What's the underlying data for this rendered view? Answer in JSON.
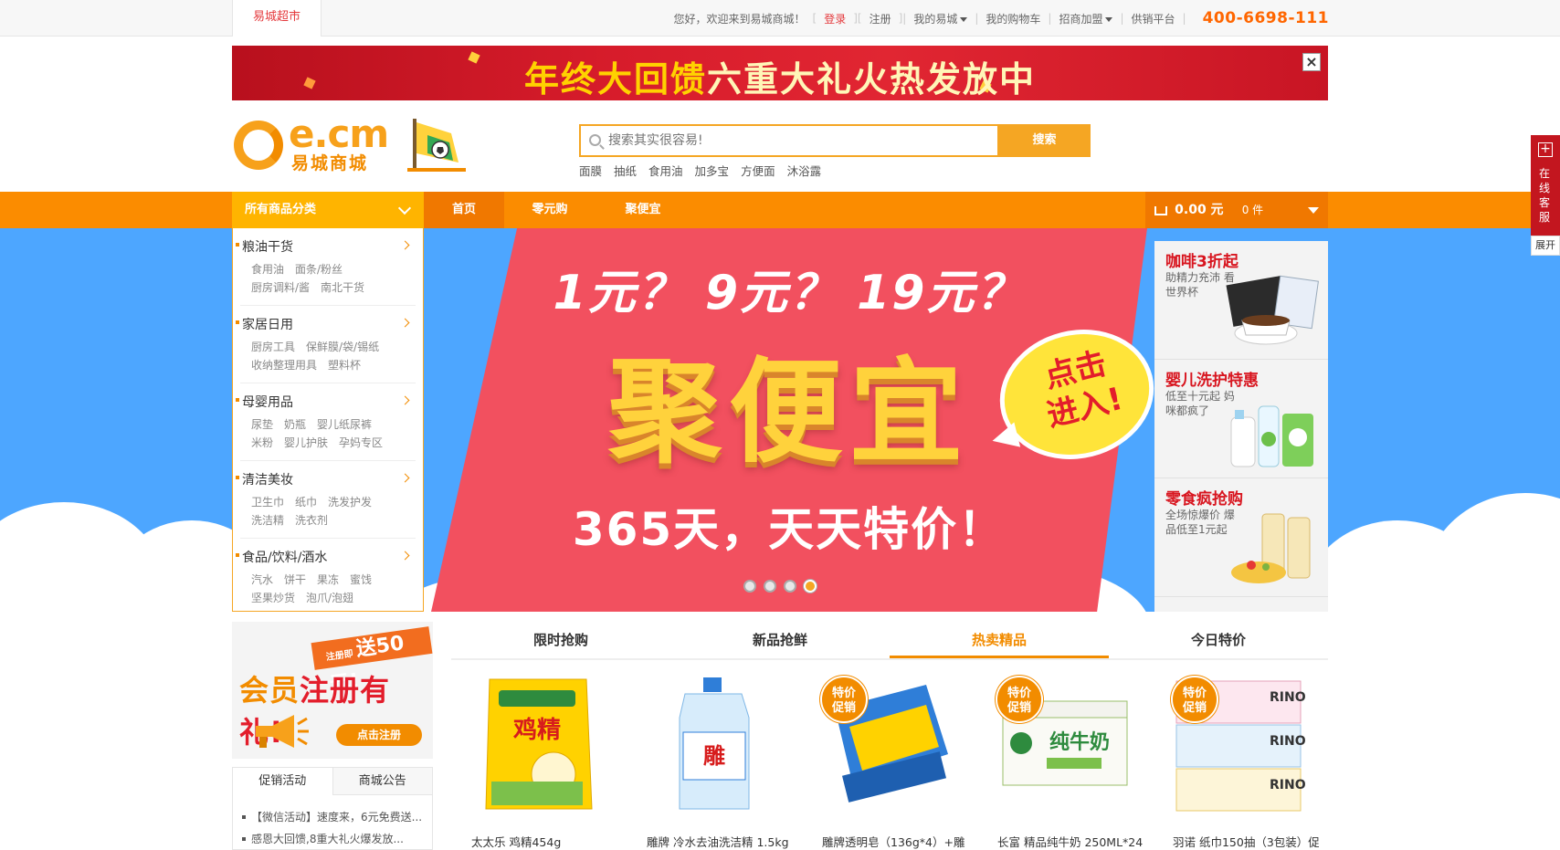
{
  "topbar": {
    "site_tab": "易城超市",
    "welcome": "您好，欢迎来到易城商城！",
    "login": "登录",
    "register": "注册",
    "my_account": "我的易城",
    "my_cart": "我的购物车",
    "join": "招商加盟",
    "supply": "供销平台",
    "hotline": "400-6698-111"
  },
  "promo_banner": {
    "text_a": "年终大回馈",
    "text_b": "六重大礼火热发放中",
    "close": "×"
  },
  "header": {
    "logo_mark": "e.cm",
    "logo_name": "易城商城",
    "search_placeholder": "搜索其实很容易!",
    "search_button": "搜索",
    "hot_words": [
      "面膜",
      "抽纸",
      "食用油",
      "加多宝",
      "方便面",
      "沐浴露"
    ]
  },
  "nav": {
    "all_categories": "所有商品分类",
    "items": [
      "首页",
      "零元购",
      "聚便宜"
    ],
    "cart_amount": "0.00 元",
    "cart_count": "0 件"
  },
  "categories": [
    {
      "title": "粮油干货",
      "rows": [
        [
          "食用油",
          "面条/粉丝"
        ],
        [
          "厨房调料/酱",
          "南北干货"
        ]
      ]
    },
    {
      "title": "家居日用",
      "rows": [
        [
          "厨房工具",
          "保鲜膜/袋/锡纸"
        ],
        [
          "收纳整理用具",
          "塑料杯"
        ]
      ]
    },
    {
      "title": "母婴用品",
      "rows": [
        [
          "尿垫",
          "奶瓶",
          "婴儿纸尿裤"
        ],
        [
          "米粉",
          "婴儿护肤",
          "孕妈专区"
        ]
      ]
    },
    {
      "title": "清洁美妆",
      "rows": [
        [
          "卫生巾",
          "纸巾",
          "洗发护发"
        ],
        [
          "洗洁精",
          "洗衣剂"
        ]
      ]
    },
    {
      "title": "食品/饮料/酒水",
      "rows": [
        [
          "汽水",
          "饼干",
          "果冻",
          "蜜饯"
        ],
        [
          "坚果炒货",
          "泡爪/泡翅"
        ]
      ]
    }
  ],
  "hero": {
    "question": "1元？  9元？  19元？",
    "title": "聚便宜",
    "subtitle": "365天，天天特价！",
    "bubble": "点击进入!",
    "slide_count": 4,
    "active_slide": 4
  },
  "side_promos": [
    {
      "title": "咖啡3折起",
      "sub": "助精力充沛 看世界杯"
    },
    {
      "title": "婴儿洗护特惠",
      "sub": "低至十元起 妈咪都疯了"
    },
    {
      "title": "零食疯抢购",
      "sub": "全场惊爆价 爆品低至1元起"
    }
  ],
  "member": {
    "tag": "送50元!",
    "tag_small": "注册即",
    "title_a": "会员",
    "title_b": "注册有礼!",
    "button": "点击注册"
  },
  "notice": {
    "tabs": [
      "促销活动",
      "商城公告"
    ],
    "items": [
      "【微信活动】速度来，6元免费送...",
      "感恩大回馈,8重大礼火爆发放..."
    ]
  },
  "product_tabs": [
    "限时抢购",
    "新品抢鲜",
    "热卖精品",
    "今日特价"
  ],
  "product_tab_active": 2,
  "products": [
    {
      "name": "太太乐 鸡精454g",
      "badge": ""
    },
    {
      "name": "雕牌 冷水去油洗洁精 1.5kg",
      "badge": ""
    },
    {
      "name": "雕牌透明皂（136g*4）+雕",
      "badge": "特价促销"
    },
    {
      "name": "长富 精品纯牛奶 250ML*24",
      "badge": "特价促销"
    },
    {
      "name": "羽诺 纸巾150抽（3包装）促",
      "badge": "特价促销"
    }
  ],
  "service": {
    "label": "在线客服",
    "expand": "展开"
  },
  "colors": {
    "accent_orange": "#fb8c00",
    "brand_yellow": "#f5a623",
    "sky_blue": "#4da6ff",
    "banner_red": "#f2505f",
    "hotline": "#ff6600"
  }
}
